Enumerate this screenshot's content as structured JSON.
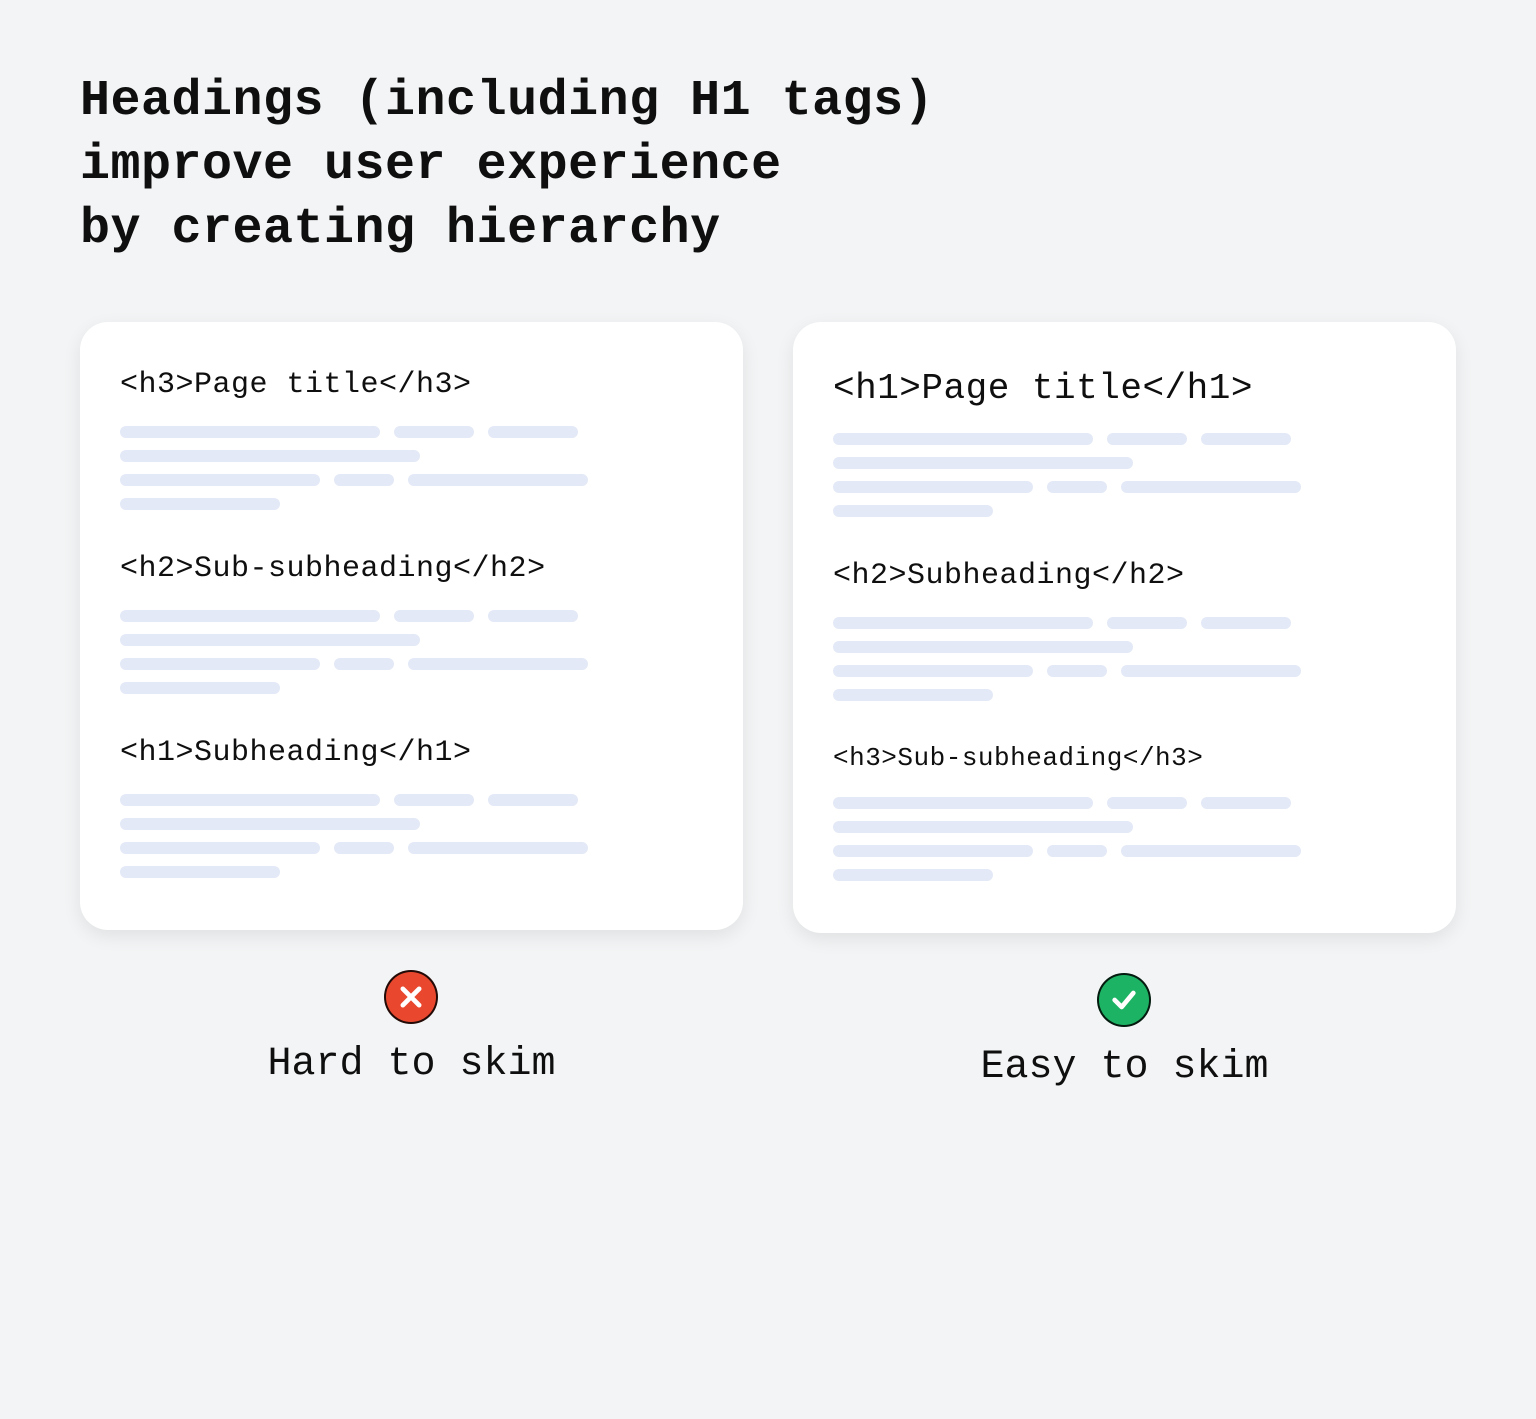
{
  "title": "Headings (including H1 tags)\nimprove user experience\nby creating hierarchy",
  "left": {
    "sections": [
      {
        "text": "<h3>Page title</h3>",
        "size": "sz-med"
      },
      {
        "text": "<h2>Sub-subheading</h2>",
        "size": "sz-med"
      },
      {
        "text": "<h1>Subheading</h1>",
        "size": "sz-med"
      }
    ],
    "caption": "Hard to skim"
  },
  "right": {
    "sections": [
      {
        "text": "<h1>Page title</h1>",
        "size": "sz-large"
      },
      {
        "text": "<h2>Subheading</h2>",
        "size": "sz-med"
      },
      {
        "text": "<h3>Sub-subheading</h3>",
        "size": "sz-small"
      }
    ],
    "caption": "Easy to skim"
  },
  "skeleton_rows": [
    [
      260,
      80,
      90
    ],
    [
      300
    ],
    [
      200,
      60,
      180
    ],
    [
      160
    ]
  ]
}
